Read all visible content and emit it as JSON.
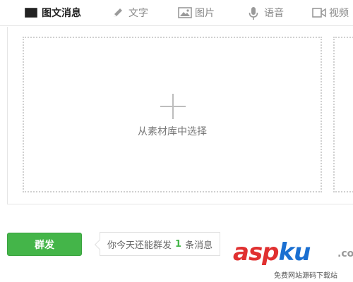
{
  "tabs": [
    {
      "label": "图文消息",
      "icon": "article-icon",
      "active": true
    },
    {
      "label": "文字",
      "icon": "pencil-icon",
      "active": false
    },
    {
      "label": "图片",
      "icon": "image-icon",
      "active": false
    },
    {
      "label": "语音",
      "icon": "microphone-icon",
      "active": false
    },
    {
      "label": "视频",
      "icon": "video-icon",
      "active": false
    }
  ],
  "content": {
    "select_from_library": "从素材库中选择"
  },
  "actions": {
    "send_label": "群发",
    "tip_prefix": "你今天还能群发",
    "tip_count": "1",
    "tip_suffix": "条消息"
  },
  "watermark": {
    "main_a": "asp",
    "main_b": "ku",
    "dot": ".com",
    "sub": "免费网站源码下载站"
  },
  "colors": {
    "accent": "#44b549",
    "watermark_red": "#e03030",
    "watermark_blue": "#1a6fd1"
  }
}
